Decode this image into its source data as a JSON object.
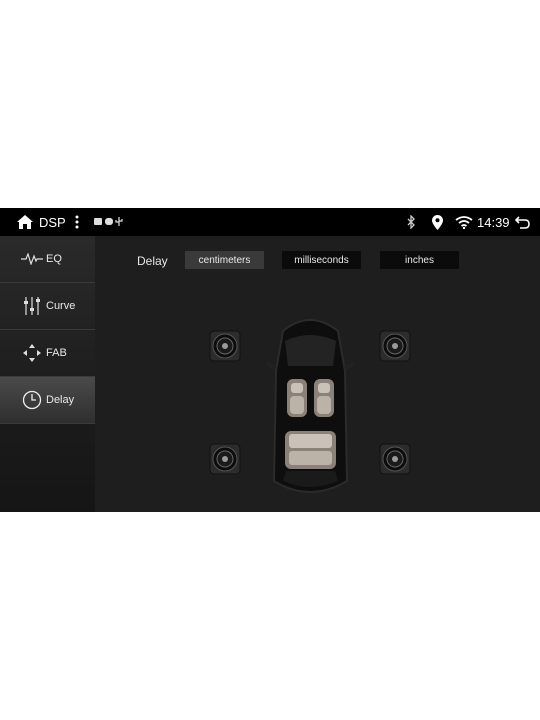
{
  "statusbar": {
    "app_title": "DSP",
    "time": "14:39",
    "icons": [
      "home-icon",
      "more-vert-icon",
      "notification-icons",
      "bluetooth-icon",
      "location-icon",
      "wifi-icon",
      "back-icon"
    ]
  },
  "sidebar": {
    "items": [
      {
        "label": "EQ",
        "icon": "waveform-icon",
        "active": false
      },
      {
        "label": "Curve",
        "icon": "sliders-icon",
        "active": false
      },
      {
        "label": "FAB",
        "icon": "fader-balance-icon",
        "active": false
      },
      {
        "label": "Delay",
        "icon": "clock-icon",
        "active": true
      }
    ]
  },
  "main": {
    "delay_label": "Delay",
    "units": [
      {
        "label": "centimeters",
        "active": true
      },
      {
        "label": "milliseconds",
        "active": false
      },
      {
        "label": "inches",
        "active": false
      }
    ],
    "speakers": [
      "front-left",
      "front-right",
      "rear-left",
      "rear-right"
    ]
  },
  "colors": {
    "background": "#1e1e1e",
    "statusbar": "#000000",
    "button": "#0b0b0b",
    "button_active": "#3a3a3a"
  }
}
